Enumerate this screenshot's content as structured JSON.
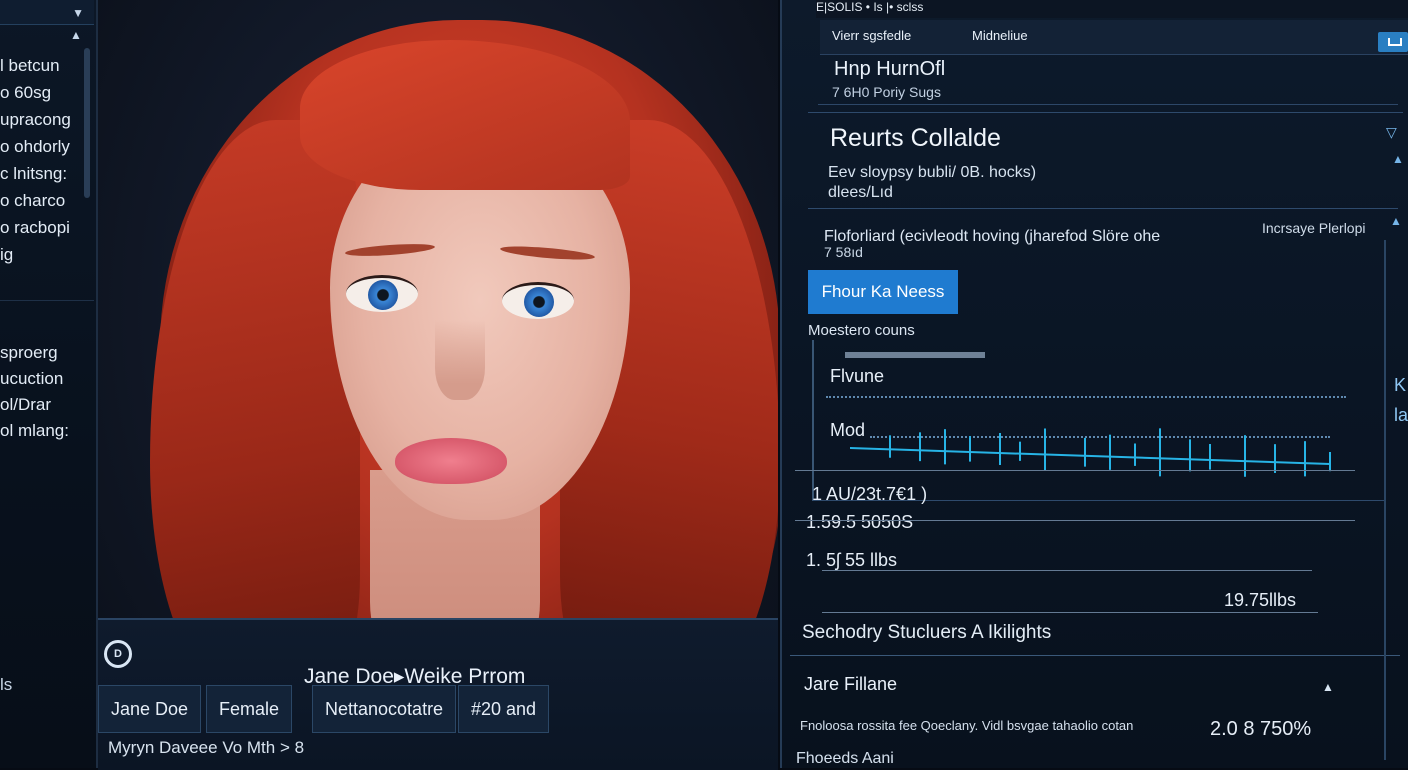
{
  "sidebar": {
    "items_top": [
      "l betcun",
      "o 60sg",
      "upracong",
      "o ohdorly",
      "c lnitsng:",
      "o charco",
      "o racbopi",
      "ig"
    ],
    "items_bottom": [
      "sproerg",
      "ucuction",
      "ol/Drar",
      "ol mlang:"
    ],
    "footer": "ls"
  },
  "photo": {
    "name_title": "Jane Doe▸Weike Prrom",
    "cells": [
      "Jane Doe",
      "Female",
      "Nettanocotatre",
      "#20 and"
    ],
    "footer": "Myryn Daveee Vo Mth  >  8"
  },
  "right_panel": {
    "topbar": "E|SOLIS   •   Is |• sclss",
    "tabs": [
      "Vierr sgsfedle",
      "Midneliue"
    ],
    "header_name": "Hnp HurnOfl",
    "header_sub": "7 6H0 Poriy Sugs",
    "section_title": "Reurts Collalde",
    "desc1": "Eev sloypsy bubli/ 0B. hocks)",
    "desc2": "dlees/Lıd",
    "desc3": "Floforliard (ecivleodt hoving (jharefod  Slöre ohe",
    "desc4": "7 58ıd",
    "side_label": "Incrsaye Plerlopi",
    "highlight_button": "Fhour Ka Neess",
    "measure_label": "Moestero couns",
    "row1_label": "Flvune",
    "row2_label": "Mod",
    "value1": "1 AU/23t.7€1 )",
    "value2": "1.59.5 5050S",
    "value3": "1. 5ʃ 55 llbs",
    "value4": "19.75llbs",
    "signature_title": "Sechodry Stucluers A Ikilights",
    "signature_name": "Jare Fillane",
    "signature_value": "2.0 8 750%",
    "signature_desc": "Fnoloosa rossita fee Qoeclany. Vidl bsvgae tahaolio cotan",
    "signature_foot": "Fhoeeds Aani",
    "far_right": [
      "K",
      "la"
    ]
  },
  "colors": {
    "accent": "#1f7bd0",
    "waveform": "#27b4e6",
    "background": "#060b14"
  }
}
